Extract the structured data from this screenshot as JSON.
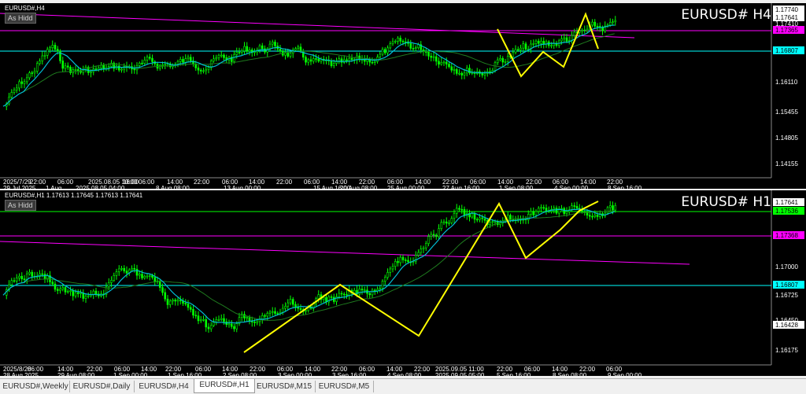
{
  "h4": {
    "symbol_line": "EURUSD#,H4",
    "as_hidden": "As Hidd",
    "title": "EURUSD# H4",
    "price_labels": [
      {
        "text": "1.17740",
        "style": "white"
      },
      {
        "text": "1.17641",
        "style": "white"
      },
      {
        "text": "1.17410",
        "style": "plain"
      },
      {
        "text": "1.17365",
        "style": "magenta"
      },
      {
        "text": "1.16807",
        "style": "cyan"
      },
      {
        "text": "1.16110",
        "style": "plain"
      },
      {
        "text": "1.15455",
        "style": "plain"
      },
      {
        "text": "1.14805",
        "style": "plain"
      },
      {
        "text": "1.14155",
        "style": "plain"
      }
    ],
    "time_labels": [
      "2025/7/29",
      "29 Jul 2025",
      "22:00",
      "1 Aug",
      "06:00",
      "2025.08.05 04:00",
      "2025.08.05 10:00",
      "16:00",
      "06:00",
      "8 Aug 08:00",
      "14:00",
      "22:00",
      "06:00",
      "13 Aug 00:00",
      "14:00",
      "22:00",
      "06:00",
      "15 Aug 16:00",
      "14:00",
      "20 Aug 08:00",
      "22:00",
      "06:00",
      "25 Aug 00:00",
      "14:00",
      "22:00",
      "27 Aug 16:00",
      "06:00",
      "14:00",
      "1 Sep 08:00",
      "22:00",
      "06:00",
      "4 Sep 00:00",
      "14:00",
      "22:00",
      "8 Sep 16:00"
    ]
  },
  "h1": {
    "symbol_line": "EURUSD#,H1  1.17613 1.17645 1.17613 1.17641",
    "as_hidden": "As Hidd",
    "title": "EURUSD# H1",
    "price_labels": [
      {
        "text": "1.17641",
        "style": "white"
      },
      {
        "text": "1.17536",
        "style": "green"
      },
      {
        "text": "1.17368",
        "style": "magenta"
      },
      {
        "text": "1.17000",
        "style": "plain"
      },
      {
        "text": "1.16807",
        "style": "cyan"
      },
      {
        "text": "1.16725",
        "style": "plain"
      },
      {
        "text": "1.16450",
        "style": "plain"
      },
      {
        "text": "1.16428",
        "style": "white"
      },
      {
        "text": "1.16175",
        "style": "plain"
      }
    ],
    "time_labels": [
      "2025/8/28",
      "28 Aug 2025",
      "06:00",
      "14:00",
      "29 Aug 08:00",
      "22:00",
      "06:00",
      "1 Sep 00:00",
      "14:00",
      "22:00",
      "1 Sep 16:00",
      "06:00",
      "14:00",
      "2 Sep 08:00",
      "22:00",
      "06:00",
      "3 Sep 00:00",
      "14:00",
      "22:00",
      "3 Sep 16:00",
      "06:00",
      "14:00",
      "4 Sep 08:00",
      "22:00",
      "2025.09.05 05:00",
      "2025.09.05 11:00",
      "22:00",
      "5 Sep 16:00",
      "06:00",
      "14:00",
      "8 Sep 08:00",
      "22:00",
      "06:00",
      "9 Sep 00:00"
    ]
  },
  "tabs": [
    {
      "label": "EURUSD#,Weekly",
      "active": false
    },
    {
      "label": "EURUSD#,Daily",
      "active": false
    },
    {
      "label": "EURUSD#,H4",
      "active": false
    },
    {
      "label": "EURUSD#,H1",
      "active": true
    },
    {
      "label": "EURUSD#,M15",
      "active": false
    },
    {
      "label": "EURUSD#,M5",
      "active": false
    }
  ],
  "colors": {
    "candle_up": "#00ff00",
    "zigzag": "#ffff00",
    "ma_fast": "#00bcd4",
    "ma_slow": "#1e7a1e",
    "trendline": "#ff00ff",
    "level_cyan": "#00ffff",
    "level_green": "#00ff00",
    "level_magenta": "#ff00ff"
  }
}
